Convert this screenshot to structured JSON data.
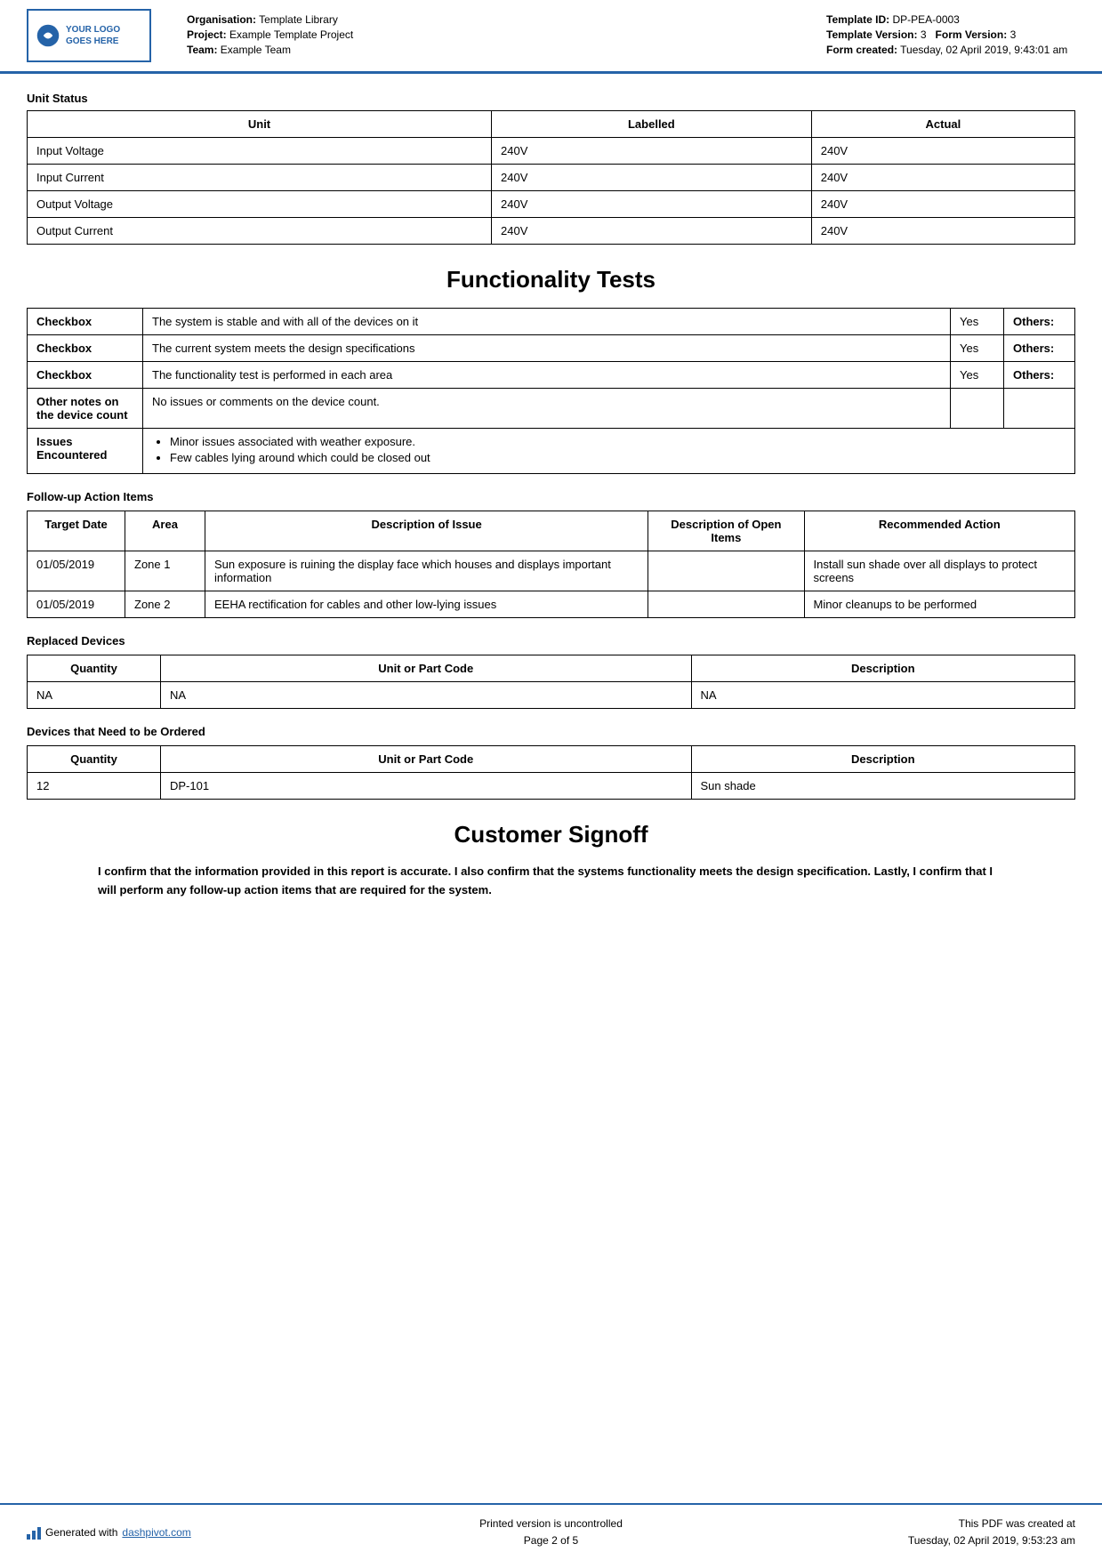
{
  "header": {
    "logo_text": "YOUR LOGO GOES HERE",
    "org_label": "Organisation:",
    "org_value": "Template Library",
    "project_label": "Project:",
    "project_value": "Example Template Project",
    "team_label": "Team:",
    "team_value": "Example Team",
    "template_id_label": "Template ID:",
    "template_id_value": "DP-PEA-0003",
    "template_version_label": "Template Version:",
    "template_version_value": "3",
    "form_version_label": "Form Version:",
    "form_version_value": "3",
    "form_created_label": "Form created:",
    "form_created_value": "Tuesday, 02 April 2019, 9:43:01 am"
  },
  "unit_status": {
    "label": "Unit Status",
    "columns": [
      "Unit",
      "Labelled",
      "Actual"
    ],
    "rows": [
      [
        "Input Voltage",
        "240V",
        "240V"
      ],
      [
        "Input Current",
        "240V",
        "240V"
      ],
      [
        "Output Voltage",
        "240V",
        "240V"
      ],
      [
        "Output Current",
        "240V",
        "240V"
      ]
    ]
  },
  "functionality_tests": {
    "heading": "Functionality Tests",
    "rows": [
      {
        "label": "Checkbox",
        "description": "The system is stable and with all of the devices on it",
        "value": "Yes",
        "others_label": "Others:"
      },
      {
        "label": "Checkbox",
        "description": "The current system meets the design specifications",
        "value": "Yes",
        "others_label": "Others:"
      },
      {
        "label": "Checkbox",
        "description": "The functionality test is performed in each area",
        "value": "Yes",
        "others_label": "Others:"
      },
      {
        "label": "Other notes on the device count",
        "description": "No issues or comments on the device count.",
        "value": "",
        "others_label": ""
      },
      {
        "label": "Issues Encountered",
        "issues": [
          "Minor issues associated with weather exposure.",
          "Few cables lying around which could be closed out"
        ]
      }
    ]
  },
  "follow_up": {
    "label": "Follow-up Action Items",
    "columns": [
      "Target Date",
      "Area",
      "Description of Issue",
      "Description of Open Items",
      "Recommended Action"
    ],
    "rows": [
      {
        "target_date": "01/05/2019",
        "area": "Zone 1",
        "description": "Sun exposure is ruining the display face which houses and displays important information",
        "open_items": "",
        "recommended": "Install sun shade over all displays to protect screens"
      },
      {
        "target_date": "01/05/2019",
        "area": "Zone 2",
        "description": "EEHA rectification for cables and other low-lying issues",
        "open_items": "",
        "recommended": "Minor cleanups to be performed"
      }
    ]
  },
  "replaced_devices": {
    "label": "Replaced Devices",
    "columns": [
      "Quantity",
      "Unit or Part Code",
      "Description"
    ],
    "rows": [
      [
        "NA",
        "NA",
        "NA"
      ]
    ]
  },
  "devices_to_order": {
    "label": "Devices that Need to be Ordered",
    "columns": [
      "Quantity",
      "Unit or Part Code",
      "Description"
    ],
    "rows": [
      [
        "12",
        "DP-101",
        "Sun shade"
      ]
    ]
  },
  "customer_signoff": {
    "heading": "Customer Signoff",
    "text": "I confirm that the information provided in this report is accurate. I also confirm that the systems functionality meets the design specification. Lastly, I confirm that I will perform any follow-up action items that are required for the system."
  },
  "footer": {
    "generated_label": "Generated with ",
    "dashpivot_url": "dashpivot.com",
    "center_line1": "Printed version is uncontrolled",
    "center_line2": "Page 2 of 5",
    "right_line1": "This PDF was created at",
    "right_line2": "Tuesday, 02 April 2019, 9:53:23 am"
  }
}
